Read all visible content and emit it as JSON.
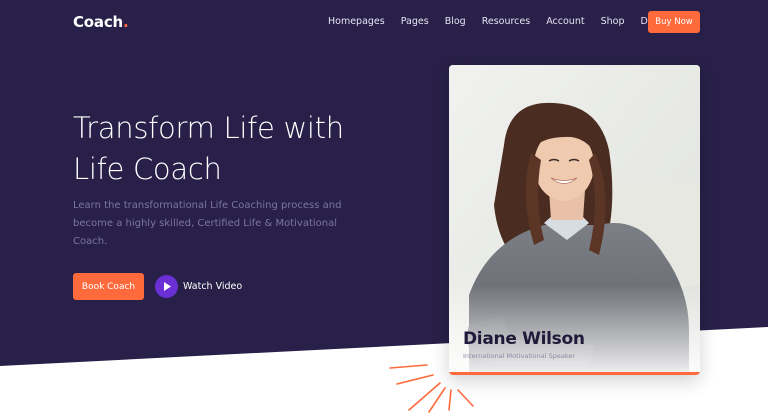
{
  "header": {
    "brand": "Coach",
    "brand_dot": ".",
    "nav": [
      {
        "label": "Homepages"
      },
      {
        "label": "Pages"
      },
      {
        "label": "Blog"
      },
      {
        "label": "Resources"
      },
      {
        "label": "Account"
      },
      {
        "label": "Shop"
      },
      {
        "label": "Docs"
      }
    ],
    "cta": "Buy Now"
  },
  "hero": {
    "headline_line1": "Transform Life with",
    "headline_line2": "Life Coach",
    "subtext": "Learn the transformational Life Coaching process and become a highly skilled, Certified Life & Motivational Coach.",
    "primary_button": "Book Coach",
    "video_label": "Watch Video"
  },
  "profile_card": {
    "name": "Diane Wilson",
    "role": "International Motivational Speaker"
  },
  "colors": {
    "hero_background": "#282048",
    "accent": "#ff6a3d",
    "play_button": "#6b2fd6"
  }
}
